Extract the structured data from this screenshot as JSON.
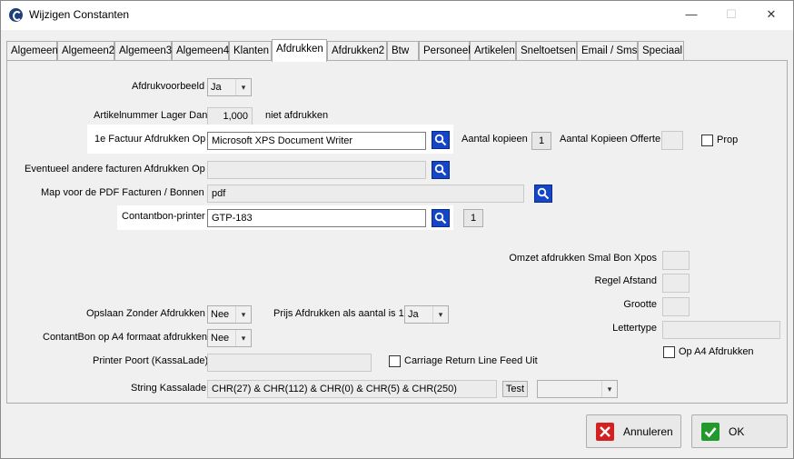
{
  "window": {
    "title": "Wijzigen Constanten",
    "minimize": "—",
    "maximize": "☐",
    "close": "✕"
  },
  "tabs": [
    "Algemeen",
    "Algemeen2",
    "Algemeen3",
    "Algemeen4",
    "Klanten",
    "Afdrukken",
    "Afdrukken2",
    "Btw",
    "Personeel",
    "Artikelen",
    "Sneltoetsen",
    "Email / Sms",
    "Speciaal"
  ],
  "active_tab": "Afdrukken",
  "form": {
    "afdrukvoorbeeld_label": "Afdrukvoorbeeld",
    "afdrukvoorbeeld_value": "Ja",
    "artikelnummer_label": "Artikelnummer Lager Dan",
    "artikelnummer_value": "1,000",
    "artikelnummer_suffix": "niet afdrukken",
    "factuur_label": "1e Factuur Afdrukken Op",
    "factuur_value": "Microsoft XPS Document Writer",
    "aantal_kopieen_label": "Aantal kopieen",
    "aantal_kopieen_value": "1",
    "aantal_kopieen_offerte_label": "Aantal Kopieen Offerte",
    "aantal_kopieen_offerte_value": "",
    "prop_label": "Prop",
    "andere_facturen_label": "Eventueel andere facturen Afdrukken Op",
    "andere_facturen_value": "",
    "pdf_map_label": "Map voor de PDF Facturen / Bonnen",
    "pdf_map_value": "pdf",
    "contantbon_printer_label": "Contantbon-printer",
    "contantbon_printer_value": "GTP-183",
    "contantbon_printer_count": "1",
    "omzet_label": "Omzet afdrukken Smal  Bon Xpos",
    "omzet_value": "",
    "regel_afstand_label": "Regel Afstand",
    "regel_afstand_value": "",
    "grootte_label": "Grootte",
    "grootte_value": "",
    "lettertype_label": "Lettertype",
    "lettertype_value": "",
    "op_a4_label": "Op A4 Afdrukken",
    "opslaan_label": "Opslaan Zonder Afdrukken",
    "opslaan_value": "Nee",
    "prijs_label": "Prijs Afdrukken als aantal is 1",
    "prijs_value": "Ja",
    "contantbon_a4_label": "ContantBon op A4 formaat afdrukken",
    "contantbon_a4_value": "Nee",
    "printer_poort_label": "Printer Poort (KassaLade)",
    "printer_poort_value": "",
    "carriage_label": "Carriage Return Line Feed Uit",
    "string_kassalade_label": "String Kassalade",
    "string_kassalade_value": "CHR(27) & CHR(112) & CHR(0) & CHR(5) & CHR(250)",
    "test_label": "Test",
    "string_combo_value": ""
  },
  "buttons": {
    "annuleren": "Annuleren",
    "ok": "OK"
  },
  "colors": {
    "accent_blue": "#1646c8",
    "cancel_red": "#d42020",
    "ok_green": "#1f9a2b"
  }
}
